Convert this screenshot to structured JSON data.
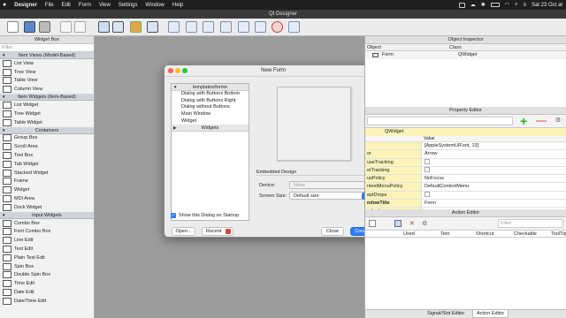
{
  "menubar": {
    "items": [
      "Designer",
      "File",
      "Edit",
      "Form",
      "View",
      "Settings",
      "Window",
      "Help"
    ],
    "datetime": "Sat 23 Oct at"
  },
  "window": {
    "title": "Qt Designer"
  },
  "widget_box": {
    "title": "Widget Box",
    "filter_placeholder": "Filter",
    "categories": [
      {
        "name": "Item Views (Model-Based)",
        "items": [
          "List View",
          "Tree View",
          "Table View",
          "Column View"
        ]
      },
      {
        "name": "Item Widgets (Item-Based)",
        "items": [
          "List Widget",
          "Tree Widget",
          "Table Widget"
        ]
      },
      {
        "name": "Containers",
        "items": [
          "Group Box",
          "Scroll Area",
          "Tool Box",
          "Tab Widget",
          "Stacked Widget",
          "Frame",
          "Widget",
          "MDI Area",
          "Dock Widget"
        ]
      },
      {
        "name": "Input Widgets",
        "items": [
          "Combo Box",
          "Font Combo Box",
          "Line Edit",
          "Text Edit",
          "Plain Text Edit",
          "Spin Box",
          "Double Spin Box",
          "Time Edit",
          "Date Edit",
          "Date/Time Edit"
        ]
      }
    ]
  },
  "new_form": {
    "title": "New Form",
    "templates_header": "templates/forms",
    "templates": [
      "Dialog with Buttons Bottom",
      "Dialog with Buttons Right",
      "Dialog without Buttons",
      "Main Window",
      "Widget"
    ],
    "widgets_header": "Widgets",
    "embedded_design_label": "Embedded Design",
    "device_label": "Device:",
    "device_value": "None",
    "screen_size_label": "Screen Size:",
    "screen_size_value": "Default size",
    "show_on_startup_label": "Show this Dialog on Startup",
    "show_on_startup_checked": true,
    "buttons": {
      "open": "Open...",
      "recent": "Recent",
      "close": "Close",
      "create": "Create"
    }
  },
  "object_inspector": {
    "title": "Object Inspector",
    "columns": [
      "Object",
      "Class"
    ],
    "rows": [
      {
        "object": "Form",
        "class": "QWidget"
      }
    ]
  },
  "property_editor": {
    "title": "Property Editor",
    "class_label": "QWidget",
    "value_header": "Value",
    "rows": [
      {
        "name": "",
        "value": "[AppleSystemUIFont, 13]"
      },
      {
        "name": "or",
        "value": "Arrow"
      },
      {
        "name": "useTracking",
        "value": ""
      },
      {
        "name": "etTracking",
        "value": ""
      },
      {
        "name": "usPolicy",
        "value": "NoFocus"
      },
      {
        "name": "ntextMenuPolicy",
        "value": "DefaultContextMenu"
      },
      {
        "name": "eptDrops",
        "value": ""
      },
      {
        "name": "ndowTitle",
        "value": "Form"
      },
      {
        "name": "ndowIcon",
        "value": ""
      }
    ]
  },
  "action_editor": {
    "title": "Action Editor",
    "filter_placeholder": "Filter",
    "columns": [
      "Used",
      "Text",
      "Shortcut",
      "Checkable",
      "ToolTip"
    ],
    "tabs": [
      "Signal/Slot Editor",
      "Action Editor"
    ]
  },
  "colors": {
    "accent": "#2f7cf6",
    "traffic_red": "#fc5f57",
    "traffic_yellow": "#fdbc2e",
    "traffic_green": "#29c840",
    "property_highlight": "#fbf3b8",
    "recent_badge": "#d9453a"
  }
}
